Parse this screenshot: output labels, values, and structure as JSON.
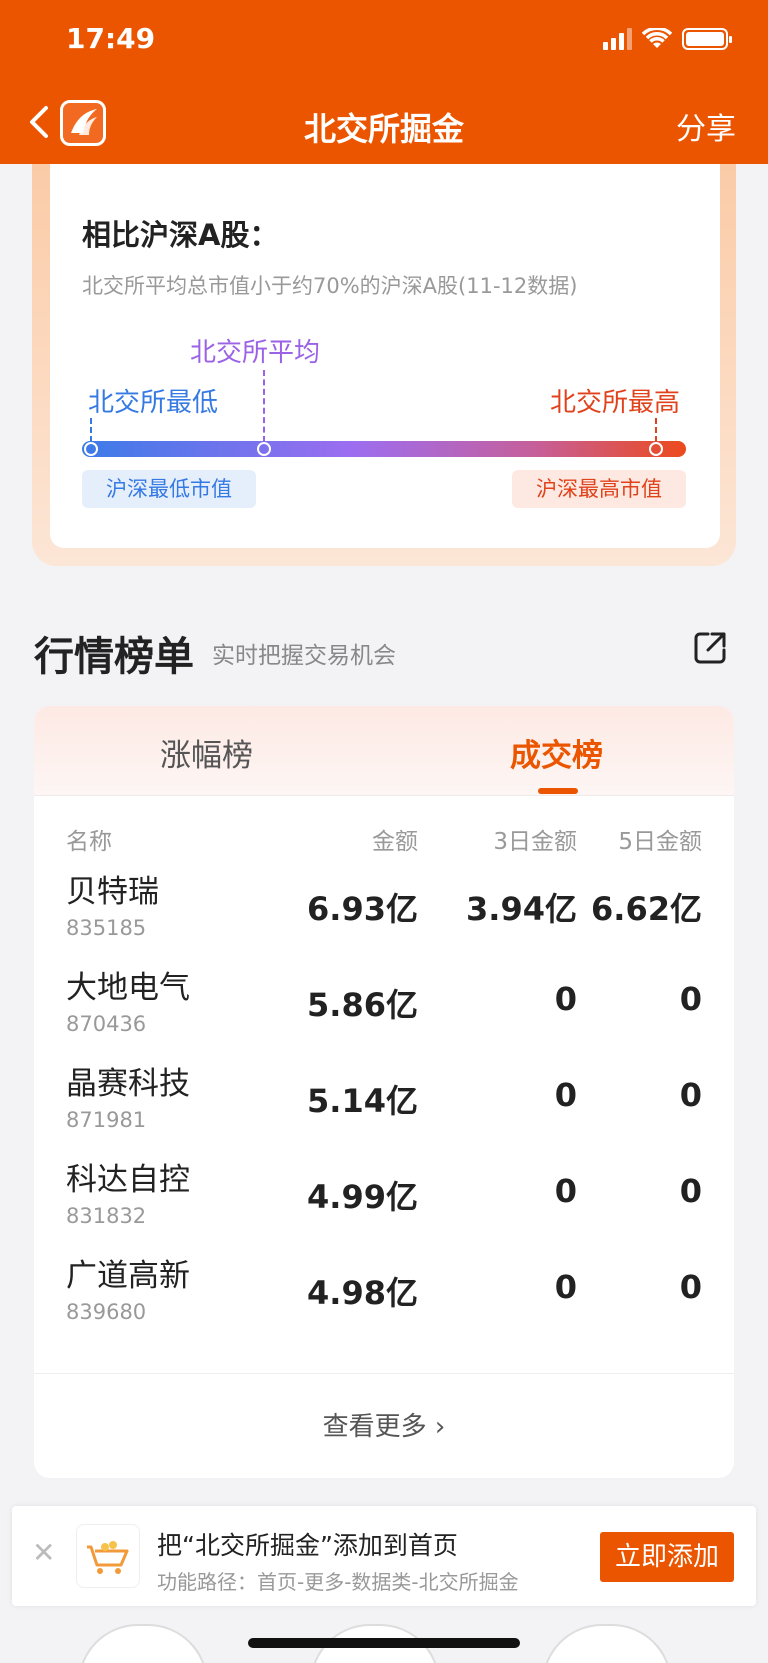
{
  "status": {
    "time": "17:49"
  },
  "header": {
    "title": "北交所掘金",
    "share": "分享"
  },
  "compare": {
    "title": "相比沪深A股：",
    "desc": "北交所平均总市值小于约70%的沪深A股(11-12数据)",
    "avg_label": "北交所平均",
    "min_label": "北交所最低",
    "max_label": "北交所最高",
    "tag_min": "沪深最低市值",
    "tag_max": "沪深最高市值",
    "colors": {
      "min": "#3579e3",
      "avg": "#9b62e5",
      "max": "#e0431c"
    }
  },
  "ranking": {
    "title": "行情榜单",
    "subtitle": "实时把握交易机会",
    "tabs": [
      "涨幅榜",
      "成交榜"
    ],
    "active_tab": "成交榜",
    "columns": [
      "名称",
      "金额",
      "3日金额",
      "5日金额"
    ],
    "rows": [
      {
        "name": "贝特瑞",
        "code": "835185",
        "amount": "6.93亿",
        "amount3": "3.94亿",
        "amount5": "6.62亿"
      },
      {
        "name": "大地电气",
        "code": "870436",
        "amount": "5.86亿",
        "amount3": "0",
        "amount5": "0"
      },
      {
        "name": "晶赛科技",
        "code": "871981",
        "amount": "5.14亿",
        "amount3": "0",
        "amount5": "0"
      },
      {
        "name": "科达自控",
        "code": "831832",
        "amount": "4.99亿",
        "amount3": "0",
        "amount5": "0"
      },
      {
        "name": "广道高新",
        "code": "839680",
        "amount": "4.98亿",
        "amount3": "0",
        "amount5": "0"
      }
    ],
    "more": "查看更多 ›"
  },
  "addbar": {
    "title": "把“北交所掘金”添加到首页",
    "path": "功能路径：首页-更多-数据类-北交所掘金",
    "button": "立即添加"
  },
  "accent": "#eb5500"
}
